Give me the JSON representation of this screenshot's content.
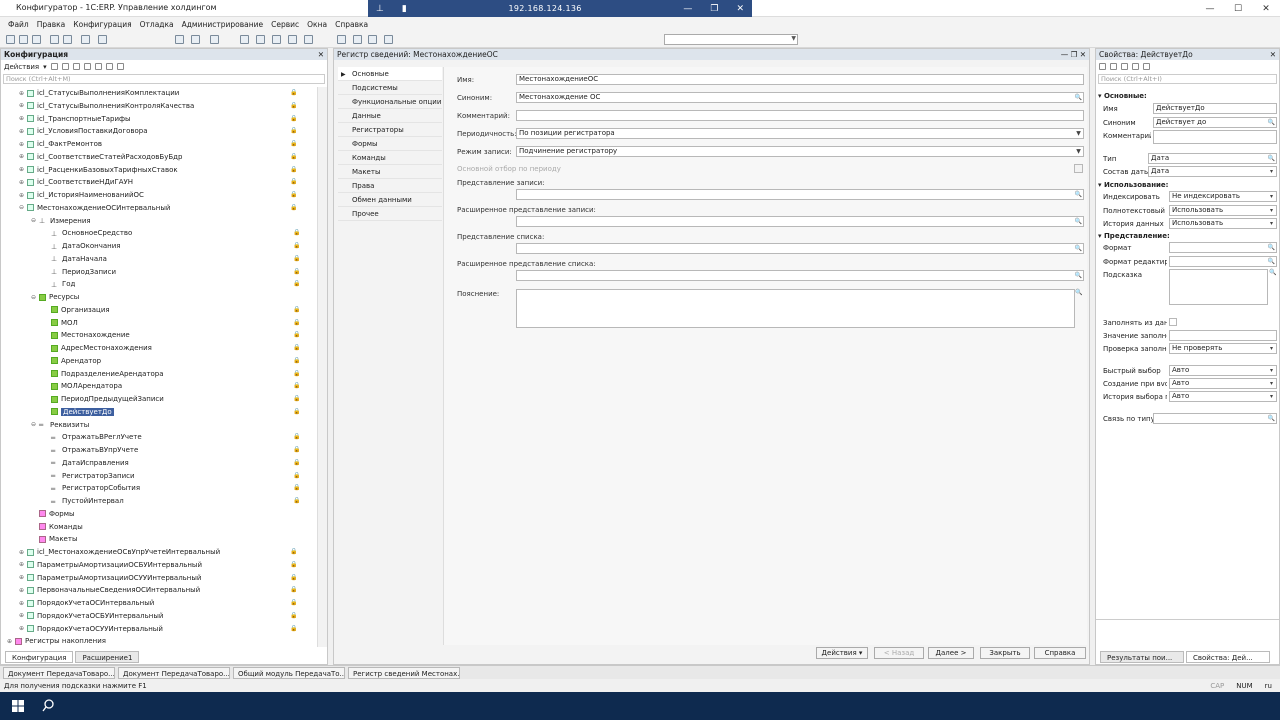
{
  "window": {
    "title": "Конфигуратор - 1С:ERP. Управление холдингом"
  },
  "remote": {
    "ip": "192.168.124.136"
  },
  "menu": [
    "Файл",
    "Правка",
    "Конфигурация",
    "Отладка",
    "Администрирование",
    "Сервис",
    "Окна",
    "Справка"
  ],
  "tree_panel": {
    "title": "Конфигурация",
    "actions_label": "Действия",
    "search_placeholder": "Поиск (Ctrl+Alt+M)",
    "rows": [
      {
        "label": "icl_СтатусыВыполненияКомплектации",
        "level": 1,
        "exp": "+",
        "kind": "reg",
        "lock": true
      },
      {
        "label": "icl_СтатусыВыполненияКонтроляКачества",
        "level": 1,
        "exp": "+",
        "kind": "reg",
        "lock": true
      },
      {
        "label": "icl_ТранспортныеТарифы",
        "level": 1,
        "exp": "+",
        "kind": "reg",
        "lock": true
      },
      {
        "label": "icl_УсловияПоставкиДоговора",
        "level": 1,
        "exp": "+",
        "kind": "reg",
        "lock": true
      },
      {
        "label": "icl_ФактРемонтов",
        "level": 1,
        "exp": "+",
        "kind": "reg",
        "lock": true
      },
      {
        "label": "icl_СоответствиеСтатейРасходовБуБдр",
        "level": 1,
        "exp": "+",
        "kind": "reg",
        "lock": true
      },
      {
        "label": "icl_РасценкиБазовыхТарифныхСтавок",
        "level": 1,
        "exp": "+",
        "kind": "reg",
        "lock": true
      },
      {
        "label": "icl_СоответствиеНДиГАУН",
        "level": 1,
        "exp": "+",
        "kind": "reg",
        "lock": true
      },
      {
        "label": "icl_ИсторияНаименованийОС",
        "level": 1,
        "exp": "+",
        "kind": "reg",
        "lock": true
      },
      {
        "label": "МестонахождениеОСИнтервальный",
        "level": 1,
        "exp": "−",
        "kind": "reg",
        "lock": true
      },
      {
        "label": "Измерения",
        "level": 2,
        "exp": "−",
        "kind": "dim",
        "lock": false
      },
      {
        "label": "ОсновноеСредство",
        "level": 3,
        "exp": "",
        "kind": "dim",
        "lock": true
      },
      {
        "label": "ДатаОкончания",
        "level": 3,
        "exp": "",
        "kind": "dim",
        "lock": true
      },
      {
        "label": "ДатаНачала",
        "level": 3,
        "exp": "",
        "kind": "dim",
        "lock": true
      },
      {
        "label": "ПериодЗаписи",
        "level": 3,
        "exp": "",
        "kind": "dim",
        "lock": true
      },
      {
        "label": "Год",
        "level": 3,
        "exp": "",
        "kind": "dim",
        "lock": true
      },
      {
        "label": "Ресурсы",
        "level": 2,
        "exp": "−",
        "kind": "res",
        "lock": false
      },
      {
        "label": "Организация",
        "level": 3,
        "exp": "",
        "kind": "res",
        "lock": true
      },
      {
        "label": "МОЛ",
        "level": 3,
        "exp": "",
        "kind": "res",
        "lock": true
      },
      {
        "label": "Местонахождение",
        "level": 3,
        "exp": "",
        "kind": "res",
        "lock": true
      },
      {
        "label": "АдресМестонахождения",
        "level": 3,
        "exp": "",
        "kind": "res",
        "lock": true
      },
      {
        "label": "Арендатор",
        "level": 3,
        "exp": "",
        "kind": "res",
        "lock": true
      },
      {
        "label": "ПодразделениеАрендатора",
        "level": 3,
        "exp": "",
        "kind": "res",
        "lock": true
      },
      {
        "label": "МОЛАрендатора",
        "level": 3,
        "exp": "",
        "kind": "res",
        "lock": true
      },
      {
        "label": "ПериодПредыдущейЗаписи",
        "level": 3,
        "exp": "",
        "kind": "res",
        "lock": true
      },
      {
        "label": "ДействуетДо",
        "level": 3,
        "exp": "",
        "kind": "res",
        "lock": true,
        "selected": true
      },
      {
        "label": "Реквизиты",
        "level": 2,
        "exp": "−",
        "kind": "attr",
        "lock": false
      },
      {
        "label": "ОтражатьВРеглУчете",
        "level": 3,
        "exp": "",
        "kind": "attr",
        "lock": true
      },
      {
        "label": "ОтражатьВУпрУчете",
        "level": 3,
        "exp": "",
        "kind": "attr",
        "lock": true
      },
      {
        "label": "ДатаИсправления",
        "level": 3,
        "exp": "",
        "kind": "attr",
        "lock": true
      },
      {
        "label": "РегистраторЗаписи",
        "level": 3,
        "exp": "",
        "kind": "attr",
        "lock": true
      },
      {
        "label": "РегистраторСобытия",
        "level": 3,
        "exp": "",
        "kind": "attr",
        "lock": true
      },
      {
        "label": "ПустойИнтервал",
        "level": 3,
        "exp": "",
        "kind": "attr",
        "lock": true
      },
      {
        "label": "Формы",
        "level": 2,
        "exp": "",
        "kind": "fold",
        "lock": false
      },
      {
        "label": "Команды",
        "level": 2,
        "exp": "",
        "kind": "fold",
        "lock": false
      },
      {
        "label": "Макеты",
        "level": 2,
        "exp": "",
        "kind": "fold",
        "lock": false
      },
      {
        "label": "icl_МестонахождениеОСвУпрУчетеИнтервальный",
        "level": 1,
        "exp": "+",
        "kind": "reg",
        "lock": true
      },
      {
        "label": "ПараметрыАмортизацииОСБУИнтервальный",
        "level": 1,
        "exp": "+",
        "kind": "reg",
        "lock": true
      },
      {
        "label": "ПараметрыАмортизацииОСУУИнтервальный",
        "level": 1,
        "exp": "+",
        "kind": "reg",
        "lock": true
      },
      {
        "label": "ПервоначальныеСведенияОСИнтервальный",
        "level": 1,
        "exp": "+",
        "kind": "reg",
        "lock": true
      },
      {
        "label": "ПорядокУчетаОСИнтервальный",
        "level": 1,
        "exp": "+",
        "kind": "reg",
        "lock": true
      },
      {
        "label": "ПорядокУчетаОСБУИнтервальный",
        "level": 1,
        "exp": "+",
        "kind": "reg",
        "lock": true
      },
      {
        "label": "ПорядокУчетаОСУУИнтервальный",
        "level": 1,
        "exp": "+",
        "kind": "reg",
        "lock": true
      },
      {
        "label": "Регистры накопления",
        "level": 0,
        "exp": "+",
        "kind": "fold",
        "lock": false
      }
    ],
    "bottom_tabs": [
      "Конфигурация",
      "Расширение1"
    ]
  },
  "editor": {
    "title": "Регистр сведений: МестонахождениеОС",
    "tabs": [
      "Основные",
      "Подсистемы",
      "Функциональные опции",
      "Данные",
      "Регистраторы",
      "Формы",
      "Команды",
      "Макеты",
      "Права",
      "Обмен данными",
      "Прочее"
    ],
    "fields": {
      "name_label": "Имя:",
      "name_value": "МестонахождениеОС",
      "synonym_label": "Синоним:",
      "synonym_value": "Местонахождение ОС",
      "comment_label": "Комментарий:",
      "comment_value": "",
      "period_label": "Периодичность:",
      "period_value": "По позиции регистратора",
      "mode_label": "Режим записи:",
      "mode_value": "Подчинение регистратору",
      "mainfilter_label": "Основной отбор по периоду",
      "record_repr_label": "Представление записи:",
      "ext_record_repr_label": "Расширенное представление записи:",
      "list_repr_label": "Представление списка:",
      "ext_list_repr_label": "Расширенное представление списка:",
      "explanation_label": "Пояснение:"
    },
    "buttons": {
      "actions": "Действия",
      "back": "< Назад",
      "next": "Далее >",
      "close": "Закрыть",
      "help": "Справка"
    }
  },
  "properties": {
    "title": "Свойства: ДействуетДо",
    "search_placeholder": "Поиск (Ctrl+Alt+I)",
    "sections": {
      "main": "Основные:",
      "usage": "Использование:",
      "repr": "Представление:"
    },
    "rows": {
      "name_label": "Имя",
      "name_value": "ДействуетДо",
      "synonym_label": "Синоним",
      "synonym_value": "Действует до",
      "comment_label": "Комментарий",
      "type_label": "Тип",
      "type_value": "Дата",
      "datecomp_label": "Состав даты",
      "datecomp_value": "Дата",
      "index_label": "Индексировать",
      "index_value": "Не индексировать",
      "fulltext_label": "Полнотекстовый п",
      "fulltext_value": "Использовать",
      "history_label": "История данных",
      "history_value": "Использовать",
      "format_label": "Формат",
      "editformat_label": "Формат редактиро",
      "tooltip_label": "Подсказка",
      "fillfrom_label": "Заполнять из данн",
      "fillvalue_label": "Значение заполне",
      "fillcheck_label": "Проверка заполне",
      "fillcheck_value": "Не проверять",
      "quick_label": "Быстрый выбор",
      "quick_value": "Авто",
      "create_label": "Создание при вvод",
      "create_value": "Авто",
      "choicehist_label": "История выбора п",
      "choicehist_value": "Авто",
      "link_label": "Связь по типу"
    },
    "bottom_tabs": [
      "Результаты пои...",
      "Свойства: Дей..."
    ]
  },
  "doc_tabs": [
    "Документ ПередачаТоваро...",
    "Документ ПередачаТоваро...",
    "Общий модуль ПередачаТо...",
    "Регистр сведений Местонах..."
  ],
  "status": {
    "hint": "Для получения подсказки нажмите F1",
    "cap": "CAP",
    "num": "NUM",
    "lang": "ru"
  }
}
